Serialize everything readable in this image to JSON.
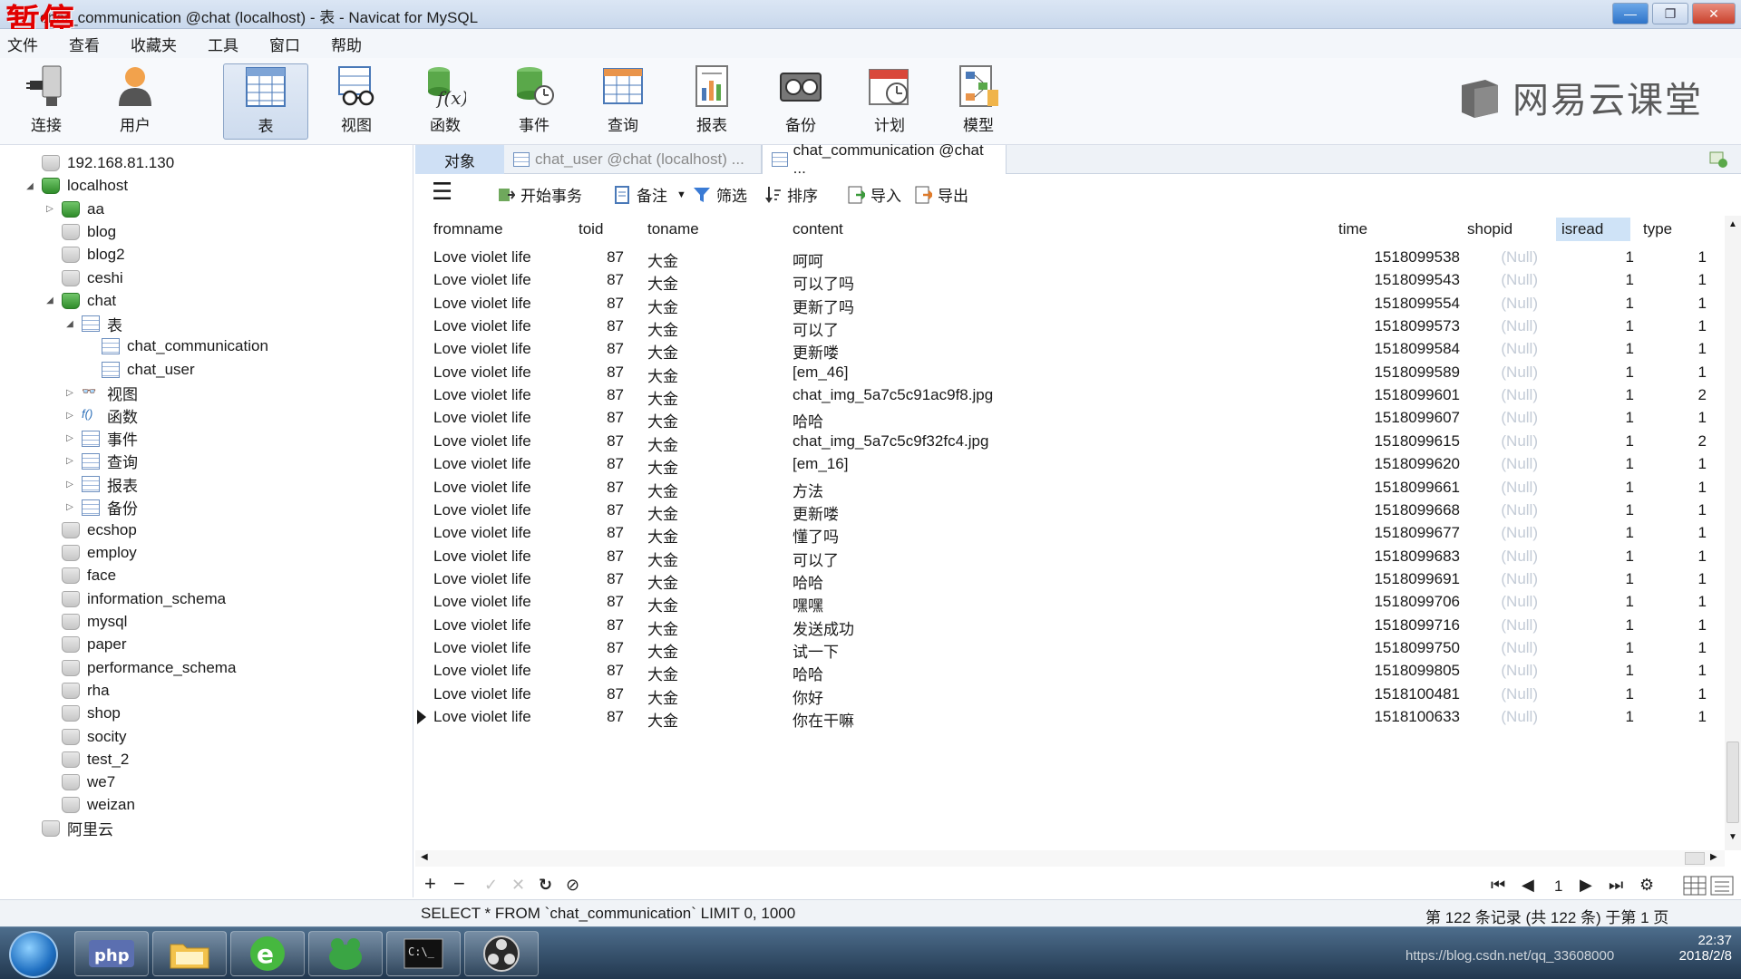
{
  "window": {
    "title": "chat_communication @chat (localhost) - 表 - Navicat for MySQL",
    "overlay": "暂停",
    "min": "—",
    "max": "❐",
    "close": "✕"
  },
  "menu": [
    "文件",
    "查看",
    "收藏夹",
    "工具",
    "窗口",
    "帮助"
  ],
  "toolbar": [
    {
      "label": "连接",
      "icon": "connection-plug-icon"
    },
    {
      "label": "用户",
      "icon": "user-icon"
    },
    {
      "label": "表",
      "icon": "table-icon"
    },
    {
      "label": "视图",
      "icon": "view-glasses-icon"
    },
    {
      "label": "函数",
      "icon": "function-icon"
    },
    {
      "label": "事件",
      "icon": "event-icon"
    },
    {
      "label": "查询",
      "icon": "query-icon"
    },
    {
      "label": "报表",
      "icon": "report-icon"
    },
    {
      "label": "备份",
      "icon": "backup-icon"
    },
    {
      "label": "计划",
      "icon": "schedule-icon"
    },
    {
      "label": "模型",
      "icon": "model-icon"
    }
  ],
  "brand": "网易云课堂",
  "tree": [
    {
      "label": "192.168.81.130",
      "level": 0,
      "type": "server-gray",
      "arrow": ""
    },
    {
      "label": "localhost",
      "level": 0,
      "type": "server-green",
      "arrow": "◢"
    },
    {
      "label": "aa",
      "level": 1,
      "type": "db-green",
      "arrow": "▷"
    },
    {
      "label": "blog",
      "level": 1,
      "type": "db-gray",
      "arrow": ""
    },
    {
      "label": "blog2",
      "level": 1,
      "type": "db-gray",
      "arrow": ""
    },
    {
      "label": "ceshi",
      "level": 1,
      "type": "db-gray",
      "arrow": ""
    },
    {
      "label": "chat",
      "level": 1,
      "type": "db-green",
      "arrow": "◢"
    },
    {
      "label": "表",
      "level": 2,
      "type": "table",
      "arrow": "◢"
    },
    {
      "label": "chat_communication",
      "level": 3,
      "type": "table",
      "arrow": ""
    },
    {
      "label": "chat_user",
      "level": 3,
      "type": "table",
      "arrow": ""
    },
    {
      "label": "视图",
      "level": 2,
      "type": "view",
      "arrow": "▷"
    },
    {
      "label": "函数",
      "level": 2,
      "type": "function",
      "arrow": "▷"
    },
    {
      "label": "事件",
      "level": 2,
      "type": "event",
      "arrow": "▷"
    },
    {
      "label": "查询",
      "level": 2,
      "type": "query",
      "arrow": "▷"
    },
    {
      "label": "报表",
      "level": 2,
      "type": "report",
      "arrow": "▷"
    },
    {
      "label": "备份",
      "level": 2,
      "type": "backup",
      "arrow": "▷"
    },
    {
      "label": "ecshop",
      "level": 1,
      "type": "db-gray",
      "arrow": ""
    },
    {
      "label": "employ",
      "level": 1,
      "type": "db-gray",
      "arrow": ""
    },
    {
      "label": "face",
      "level": 1,
      "type": "db-gray",
      "arrow": ""
    },
    {
      "label": "information_schema",
      "level": 1,
      "type": "db-gray",
      "arrow": ""
    },
    {
      "label": "mysql",
      "level": 1,
      "type": "db-gray",
      "arrow": ""
    },
    {
      "label": "paper",
      "level": 1,
      "type": "db-gray",
      "arrow": ""
    },
    {
      "label": "performance_schema",
      "level": 1,
      "type": "db-gray",
      "arrow": ""
    },
    {
      "label": "rha",
      "level": 1,
      "type": "db-gray",
      "arrow": ""
    },
    {
      "label": "shop",
      "level": 1,
      "type": "db-gray",
      "arrow": ""
    },
    {
      "label": "socity",
      "level": 1,
      "type": "db-gray",
      "arrow": ""
    },
    {
      "label": "test_2",
      "level": 1,
      "type": "db-gray",
      "arrow": ""
    },
    {
      "label": "we7",
      "level": 1,
      "type": "db-gray",
      "arrow": ""
    },
    {
      "label": "weizan",
      "level": 1,
      "type": "db-gray",
      "arrow": ""
    },
    {
      "label": "阿里云",
      "level": 0,
      "type": "server-gray",
      "arrow": ""
    }
  ],
  "tabs": {
    "objects": "对象",
    "tab1": "chat_user @chat (localhost) ...",
    "tab2": "chat_communication @chat ..."
  },
  "subtoolbar": {
    "menu": "☰",
    "begin_transaction": "开始事务",
    "memo": "备注",
    "filter": "筛选",
    "sort": "排序",
    "import": "导入",
    "export": "导出"
  },
  "grid": {
    "columns": [
      "fromname",
      "toid",
      "toname",
      "content",
      "time",
      "shopid",
      "isread",
      "type"
    ],
    "sorted_column": "isread",
    "rows": [
      [
        "Love violet life",
        "87",
        "大金",
        "呵呵",
        "1518099538",
        "(Null)",
        "1",
        "1"
      ],
      [
        "Love violet life",
        "87",
        "大金",
        "可以了吗",
        "1518099543",
        "(Null)",
        "1",
        "1"
      ],
      [
        "Love violet life",
        "87",
        "大金",
        "更新了吗",
        "1518099554",
        "(Null)",
        "1",
        "1"
      ],
      [
        "Love violet life",
        "87",
        "大金",
        "可以了",
        "1518099573",
        "(Null)",
        "1",
        "1"
      ],
      [
        "Love violet life",
        "87",
        "大金",
        "更新喽",
        "1518099584",
        "(Null)",
        "1",
        "1"
      ],
      [
        "Love violet life",
        "87",
        "大金",
        "[em_46]",
        "1518099589",
        "(Null)",
        "1",
        "1"
      ],
      [
        "Love violet life",
        "87",
        "大金",
        "chat_img_5a7c5c91ac9f8.jpg",
        "1518099601",
        "(Null)",
        "1",
        "2"
      ],
      [
        "Love violet life",
        "87",
        "大金",
        "哈哈",
        "1518099607",
        "(Null)",
        "1",
        "1"
      ],
      [
        "Love violet life",
        "87",
        "大金",
        "chat_img_5a7c5c9f32fc4.jpg",
        "1518099615",
        "(Null)",
        "1",
        "2"
      ],
      [
        "Love violet life",
        "87",
        "大金",
        "[em_16]",
        "1518099620",
        "(Null)",
        "1",
        "1"
      ],
      [
        "Love violet life",
        "87",
        "大金",
        "方法",
        "1518099661",
        "(Null)",
        "1",
        "1"
      ],
      [
        "Love violet life",
        "87",
        "大金",
        "更新喽",
        "1518099668",
        "(Null)",
        "1",
        "1"
      ],
      [
        "Love violet life",
        "87",
        "大金",
        "懂了吗",
        "1518099677",
        "(Null)",
        "1",
        "1"
      ],
      [
        "Love violet life",
        "87",
        "大金",
        "可以了",
        "1518099683",
        "(Null)",
        "1",
        "1"
      ],
      [
        "Love violet life",
        "87",
        "大金",
        "哈哈",
        "1518099691",
        "(Null)",
        "1",
        "1"
      ],
      [
        "Love violet life",
        "87",
        "大金",
        "嘿嘿",
        "1518099706",
        "(Null)",
        "1",
        "1"
      ],
      [
        "Love violet life",
        "87",
        "大金",
        "发送成功",
        "1518099716",
        "(Null)",
        "1",
        "1"
      ],
      [
        "Love violet life",
        "87",
        "大金",
        "试一下",
        "1518099750",
        "(Null)",
        "1",
        "1"
      ],
      [
        "Love violet life",
        "87",
        "大金",
        "哈哈",
        "1518099805",
        "(Null)",
        "1",
        "1"
      ],
      [
        "Love violet life",
        "87",
        "大金",
        "你好",
        "1518100481",
        "(Null)",
        "1",
        "1"
      ],
      [
        "Love violet life",
        "87",
        "大金",
        "你在干嘛",
        "1518100633",
        "(Null)",
        "1",
        "1"
      ]
    ]
  },
  "navbar": {
    "add": "+",
    "delete": "−",
    "apply": "✓",
    "discard": "✕",
    "refresh": "↻",
    "stop": "⊘",
    "first": "⏮",
    "prev": "◀",
    "page": "1",
    "next": "▶",
    "last": "⏭",
    "settings": "⚙"
  },
  "status": {
    "sql": "SELECT * FROM `chat_communication` LIMIT 0, 1000",
    "count": "第 122 条记录 (共 122 条) 于第 1 页"
  },
  "taskbar": {
    "time": "22:37",
    "date": "2018/2/8",
    "watermark": "https://blog.csdn.net/qq_33608000"
  },
  "colors": {
    "accent": "#cfe0f5",
    "null_text": "#c3cbd6",
    "overlay_red": "#e10000"
  }
}
